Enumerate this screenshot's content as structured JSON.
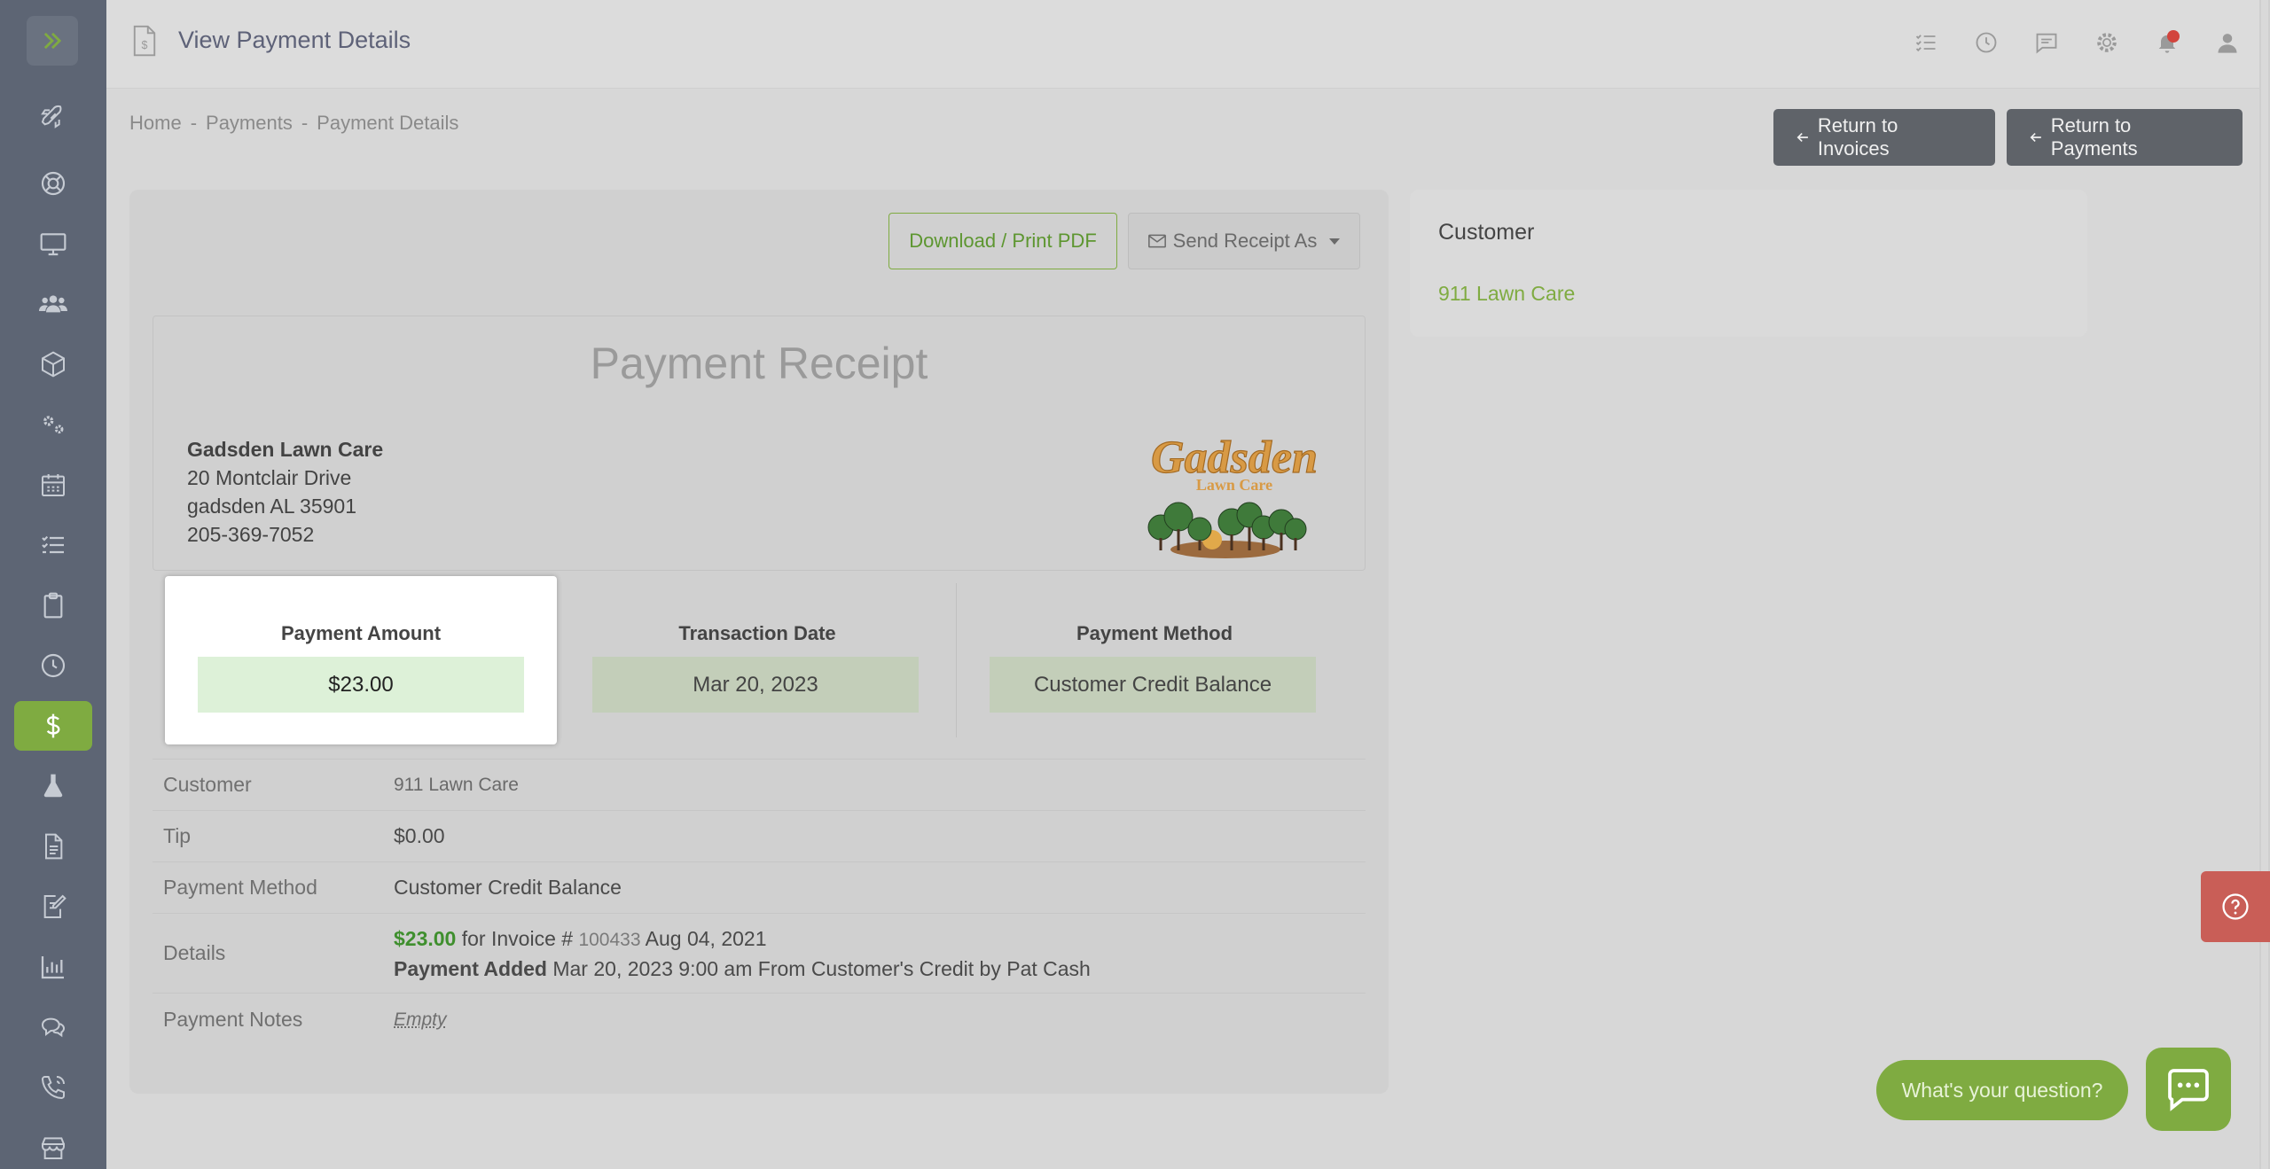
{
  "topbar": {
    "title": "View Payment Details",
    "icons": [
      "checklist-icon",
      "clock-icon",
      "chat-icon",
      "gear-icon",
      "bell-icon",
      "user-icon"
    ]
  },
  "sidebar": {
    "items": [
      "rocket-icon",
      "lifebuoy-icon",
      "monitor-icon",
      "users-icon",
      "box-icon",
      "gears-icon",
      "calendar-icon",
      "list-icon",
      "clipboard-icon",
      "clock-icon",
      "dollar-icon",
      "flask-icon",
      "document-icon",
      "edit-document-icon",
      "chart-icon",
      "comments-icon",
      "phone-icon",
      "store-icon"
    ],
    "active": "dollar-icon"
  },
  "breadcrumb": {
    "home": "Home",
    "payments": "Payments",
    "current": "Payment Details",
    "sep": "-"
  },
  "actions": {
    "return_invoices": "Return to Invoices",
    "return_payments": "Return to Payments",
    "download": "Download / Print PDF",
    "send_receipt": "Send Receipt As"
  },
  "receipt": {
    "title": "Payment Receipt",
    "company_name": "Gadsden Lawn Care",
    "address1": "20 Montclair Drive",
    "address2": "gadsden AL 35901",
    "phone": "205-369-7052",
    "logo_text1": "Gadsden",
    "logo_text2": "Lawn Care"
  },
  "stats": {
    "amount_label": "Payment Amount",
    "amount_value": "$23.00",
    "date_label": "Transaction Date",
    "date_value": "Mar 20, 2023",
    "method_label": "Payment Method",
    "method_value": "Customer Credit Balance"
  },
  "details": {
    "customer_label": "Customer",
    "customer_value": "911 Lawn Care",
    "tip_label": "Tip",
    "tip_value": "$0.00",
    "method_label": "Payment Method",
    "method_value": "Customer Credit Balance",
    "details_label": "Details",
    "details_amount": "$23.00",
    "details_for": "for Invoice #",
    "details_invoice": "100433",
    "details_invoice_date": "Aug 04, 2021",
    "details_added_label": "Payment Added",
    "details_added_text": "Mar 20, 2023 9:00 am From Customer's Credit by Pat Cash",
    "notes_label": "Payment Notes",
    "notes_value": "Empty"
  },
  "customer_card": {
    "heading": "Customer",
    "name": "911 Lawn Care"
  },
  "chat": {
    "prompt": "What's your question?"
  },
  "colors": {
    "accent": "#7fab41",
    "sidebar": "#5d6574",
    "help": "#c95e57"
  }
}
